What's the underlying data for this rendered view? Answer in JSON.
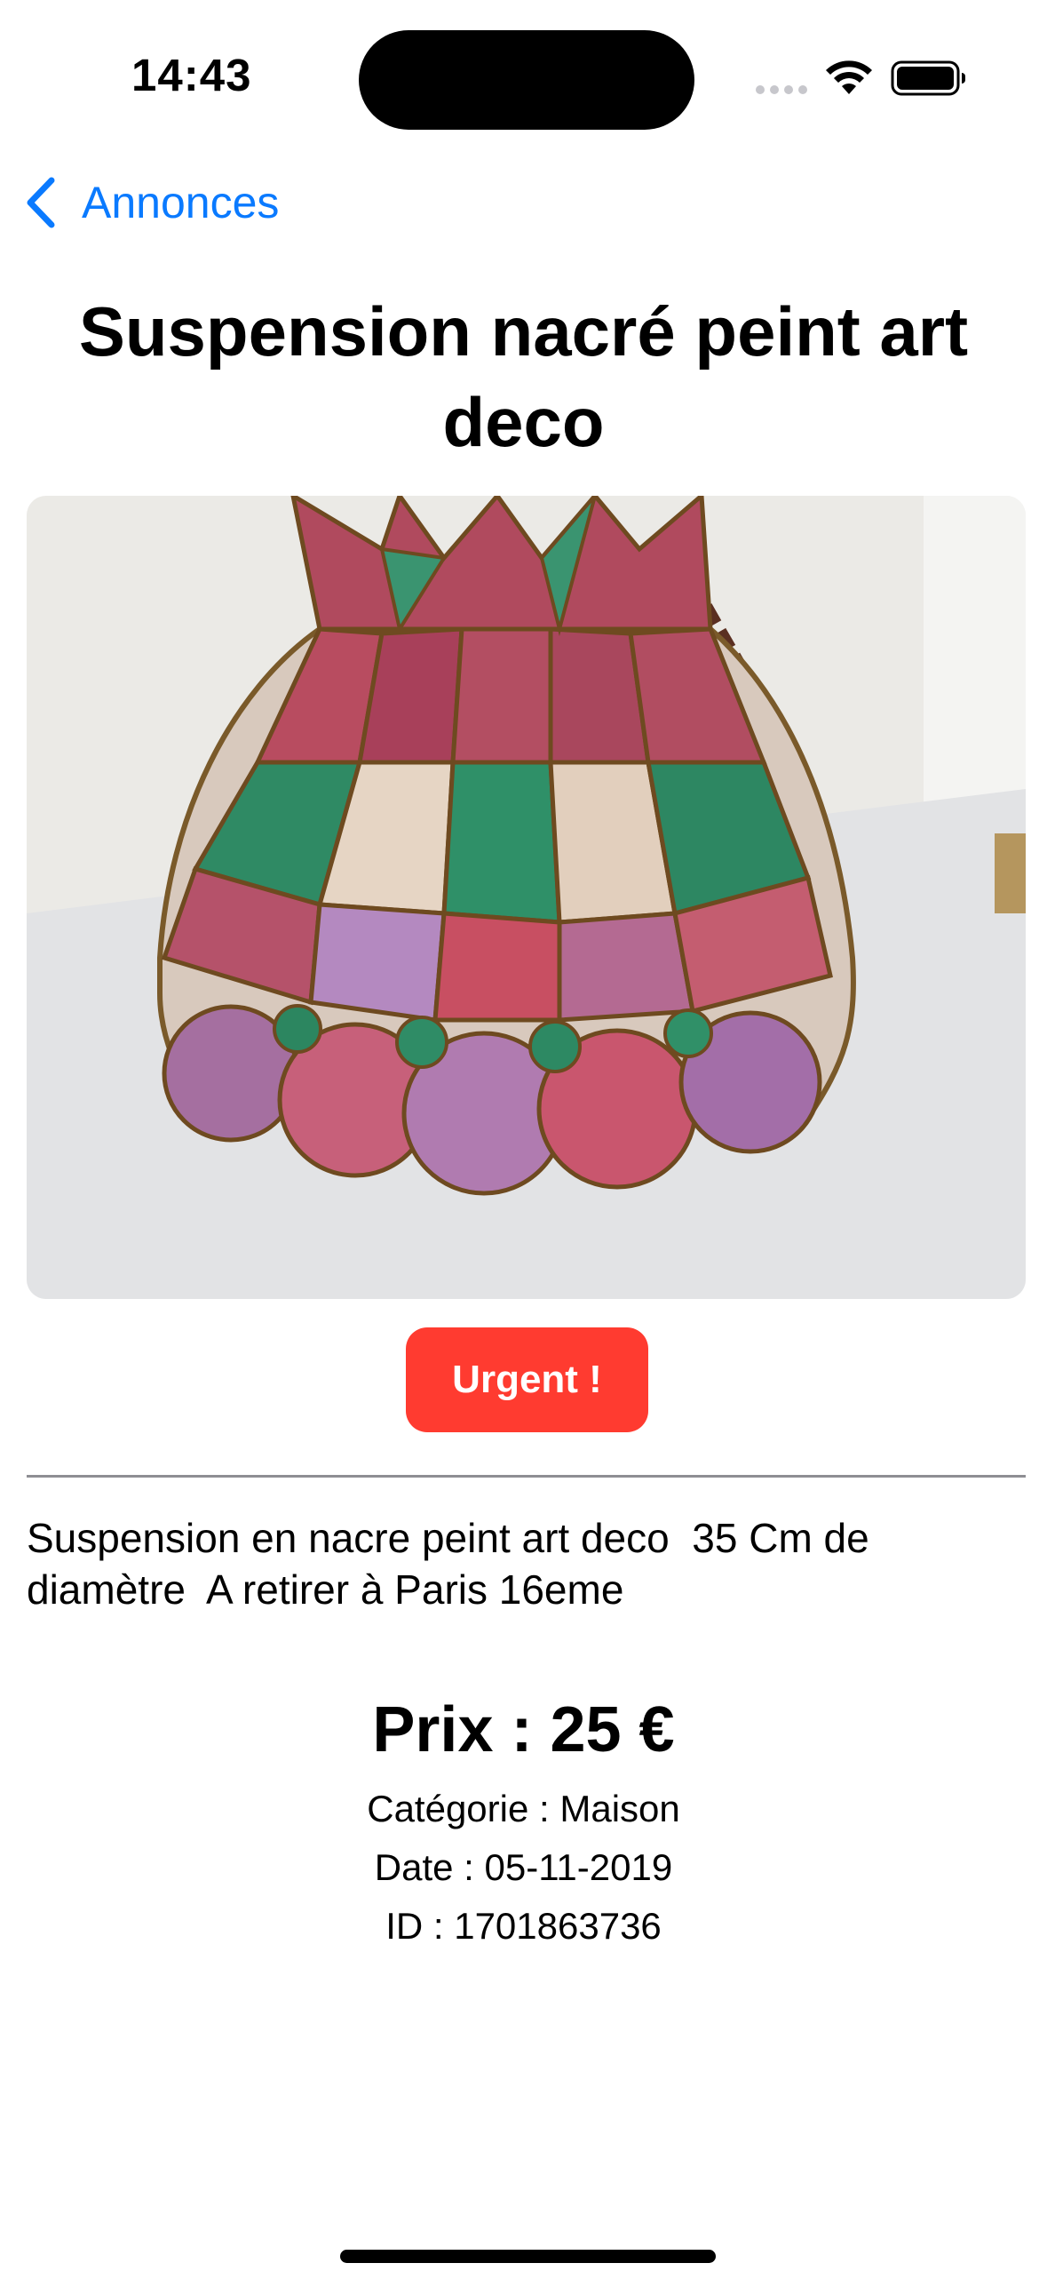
{
  "status_bar": {
    "time": "14:43",
    "icons": [
      "cellular-signal-icon",
      "wifi-icon",
      "battery-icon"
    ]
  },
  "nav": {
    "back_label": "Annonces",
    "back_icon": "chevron-left-icon"
  },
  "listing": {
    "title": "Suspension nacré peint art deco",
    "image_alt": "Stained glass mother-of-pearl pendant lamp",
    "badge": "Urgent !",
    "description": "Suspension en nacre peint art deco  35 Cm de diamètre  A retirer à Paris 16eme",
    "price": "Prix : 25 €",
    "category": "Catégorie : Maison",
    "date": "Date : 05-11-2019",
    "id": "ID : 1701863736"
  },
  "colors": {
    "accent": "#0a7aff",
    "badge": "#ff3b30",
    "divider": "#8e8e93",
    "text": "#000000"
  }
}
